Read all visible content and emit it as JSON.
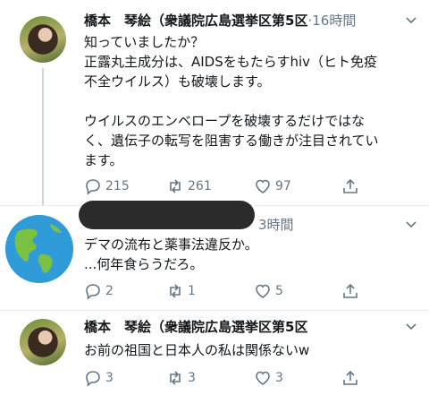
{
  "tweet1": {
    "name": "橋本　琴絵（衆議院広島選挙区第5区",
    "time": "16時間",
    "lines": [
      "知っていましたか？",
      "正露丸主成分は、AIDSをもたらすhiv（ヒト免疫",
      "不全ウイルス）も破壊します。",
      "",
      "ウイルスのエンベロープを破壊するだけではな",
      "く、遺伝子の転写を阻害する働きが注目されてい",
      "ます。"
    ],
    "reply_count": "215",
    "retweet_count": "261",
    "like_count": "97"
  },
  "tweet2": {
    "time": "3時間",
    "lines": [
      "デマの流布と薬事法違反か。",
      "...何年食らうだろ。"
    ],
    "reply_count": "2",
    "retweet_count": "1",
    "like_count": "5"
  },
  "tweet3": {
    "name": "橋本　琴絵（衆議院広島選挙区第5区",
    "lines": [
      "お前の祖国と日本人の私は関係ないw"
    ],
    "reply_count": "3",
    "retweet_count": "3",
    "like_count": "3"
  },
  "colors": {
    "meta": "#657786",
    "text": "#14171a",
    "line": "#ccd6dd"
  },
  "icons": [
    "reply-icon",
    "retweet-icon",
    "like-icon",
    "share-icon",
    "chevron-down-icon"
  ]
}
